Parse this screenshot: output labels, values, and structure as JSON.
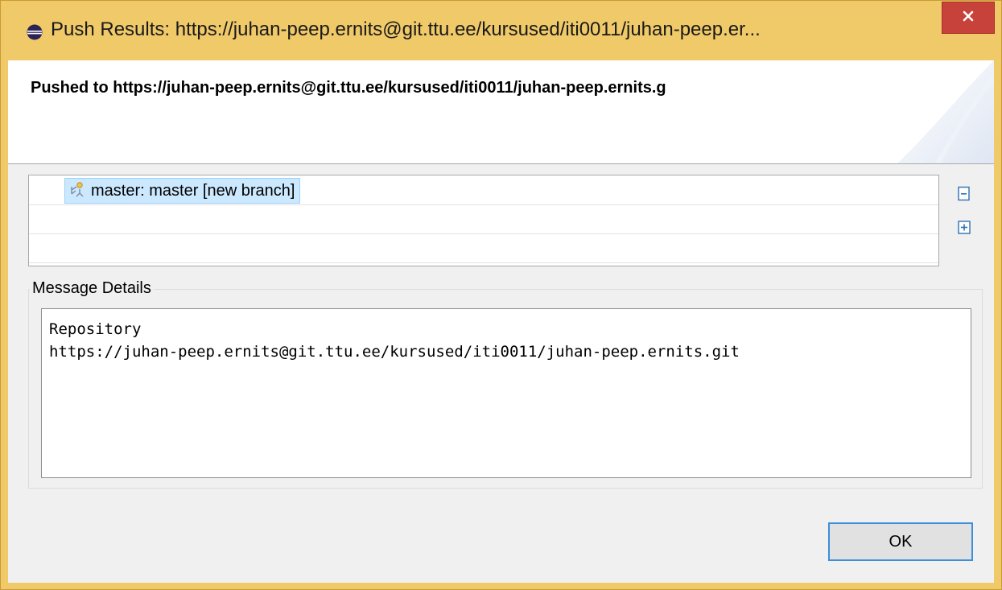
{
  "window": {
    "title": "Push Results: https://juhan-peep.ernits@git.ttu.ee/kursused/iti0011/juhan-peep.er...",
    "app_icon": "eclipse-icon",
    "close_icon": "close-icon"
  },
  "banner": {
    "message": "Pushed to https://juhan-peep.ernits@git.ttu.ee/kursused/iti0011/juhan-peep.ernits.g"
  },
  "results_tree": {
    "items": [
      {
        "label": "master: master [new branch]",
        "icon": "branch-push-icon",
        "selected": true
      }
    ],
    "collapse_all_icon": "collapse-all-icon",
    "expand_all_icon": "expand-all-icon"
  },
  "message_details": {
    "group_label": "Message Details",
    "text": "Repository\nhttps://juhan-peep.ernits@git.ttu.ee/kursused/iti0011/juhan-peep.ernits.git"
  },
  "buttons": {
    "ok_label": "OK"
  },
  "colors": {
    "frame": "#f0c969",
    "close_button": "#c7423a",
    "selection": "#cce8ff",
    "ok_focus_border": "#3c8fdc"
  }
}
